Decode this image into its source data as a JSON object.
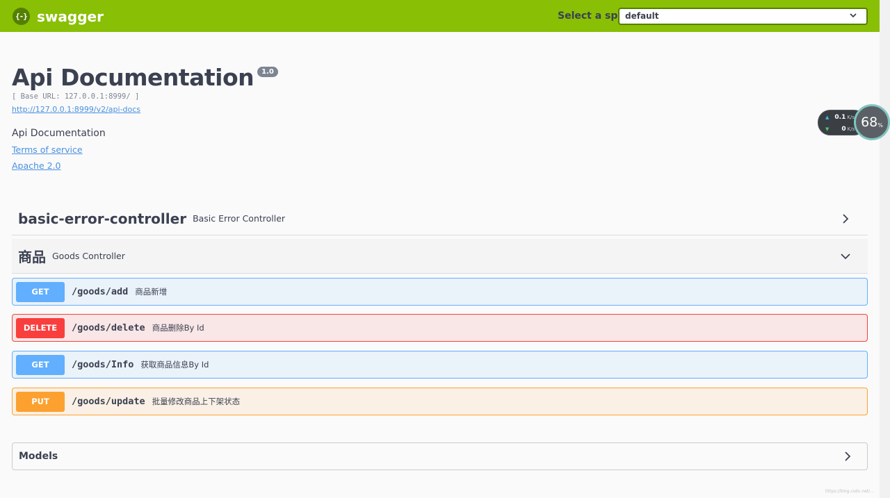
{
  "header": {
    "logo_text": "swagger",
    "logo_glyph": "{-}",
    "spec_label": "Select a spec",
    "spec_value": "default",
    "brand_color": "#89bf04"
  },
  "info": {
    "title": "Api Documentation",
    "version": "1.0",
    "base_url": "[ Base URL: 127.0.0.1:8999/ ]",
    "api_docs_url": "http://127.0.0.1:8999/v2/api-docs",
    "description": "Api Documentation",
    "terms_of_service": "Terms of service",
    "license": "Apache 2.0"
  },
  "net_widget": {
    "upload": "0.1",
    "upload_unit": "K/s",
    "download": "0",
    "download_unit": "K/s",
    "percent": "68",
    "percent_unit": "%"
  },
  "tags": [
    {
      "name": "basic-error-controller",
      "description": "Basic Error Controller",
      "expanded": false
    },
    {
      "name": "商品",
      "description": "Goods Controller",
      "expanded": true
    }
  ],
  "operations": [
    {
      "method": "GET",
      "path": "/goods/add",
      "summary": "商品新增",
      "color": "#61affe"
    },
    {
      "method": "DELETE",
      "path": "/goods/delete",
      "summary": "商品删除By Id",
      "color": "#f93e3e"
    },
    {
      "method": "GET",
      "path": "/goods/Info",
      "summary": "获取商品信息By Id",
      "color": "#61affe"
    },
    {
      "method": "PUT",
      "path": "/goods/update",
      "summary": "批量修改商品上下架状态",
      "color": "#fca130"
    }
  ],
  "models": {
    "title": "Models"
  },
  "watermark": "https://blog.csdn.net/..."
}
